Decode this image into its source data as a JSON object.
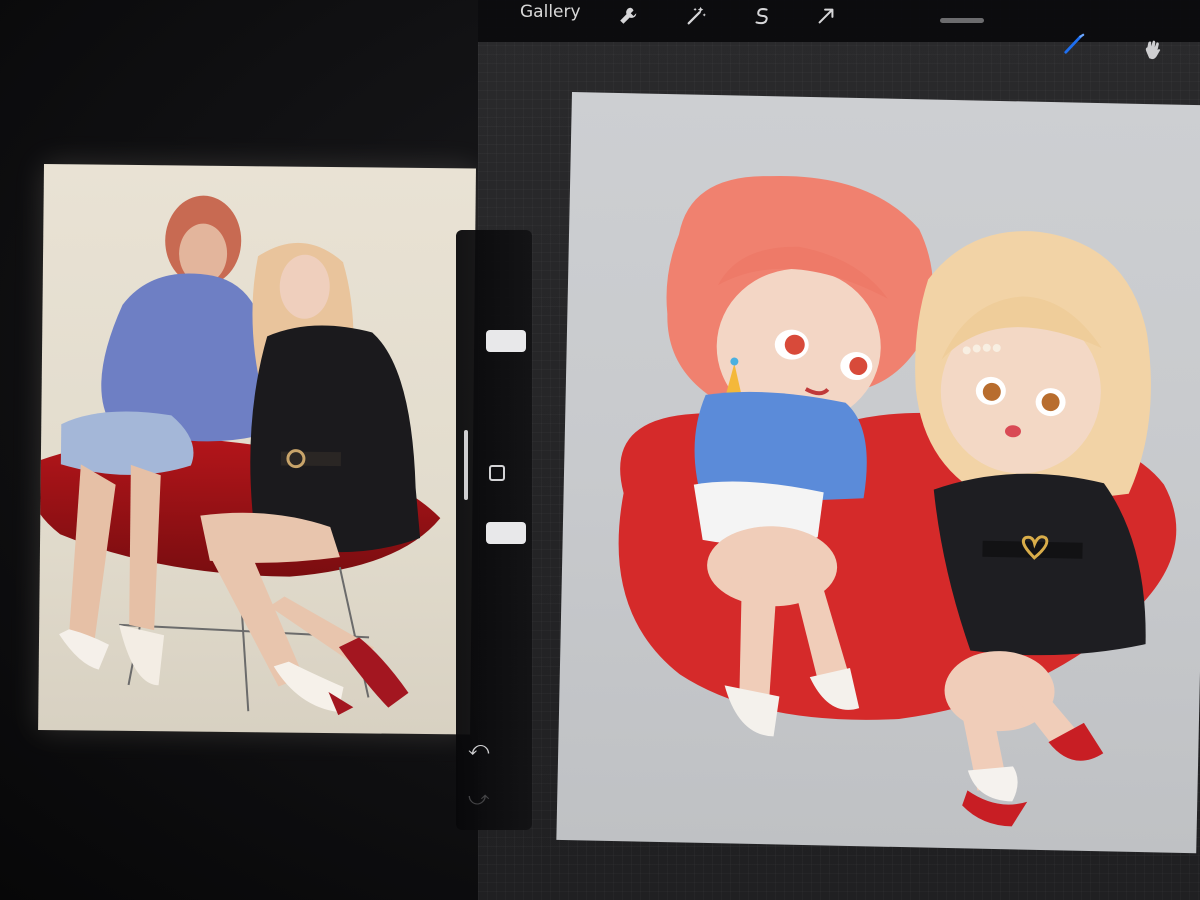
{
  "toolbar": {
    "gallery_label": "Gallery",
    "icons": [
      "wrench-icon",
      "magic-wand-icon",
      "selection-icon",
      "transform-arrow-icon",
      "brush-icon",
      "smudge-icon"
    ],
    "active_tool_color": "#1e6ff0"
  },
  "sidebar": {
    "icons": [
      "modify-square-icon",
      "undo-icon",
      "redo-icon"
    ],
    "undo_glyph": "⤺",
    "redo_glyph": "⤻"
  },
  "colors": {
    "canvas_bg": "#cacccf",
    "heart_red": "#d52a2a",
    "hair_coral": "#f0816f",
    "hair_blonde": "#f2d3a6",
    "sweater_blue": "#5b8bd9",
    "dress_black": "#1e1e22",
    "skin": "#f3d6c5"
  }
}
